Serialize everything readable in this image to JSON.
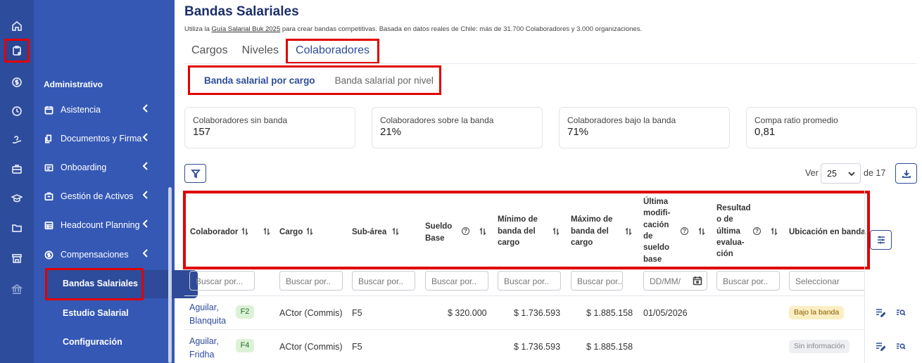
{
  "rail": {
    "icons": [
      "home-icon",
      "clipboard-icon",
      "dollar-icon",
      "clock-icon",
      "handshake-icon",
      "briefcase-icon",
      "graduation-icon",
      "folder-icon",
      "store-icon",
      "bank-icon"
    ]
  },
  "menu": {
    "section_title": "Administrativo",
    "items": [
      {
        "label": "Asistencia"
      },
      {
        "label": "Documentos y Firma"
      },
      {
        "label": "Onboarding"
      },
      {
        "label": "Gestión de Activos"
      },
      {
        "label": "Headcount Planning"
      },
      {
        "label": "Compensaciones"
      }
    ],
    "subitems": [
      {
        "label": "Bandas Salariales"
      },
      {
        "label": "Estudio Salarial"
      },
      {
        "label": "Configuración"
      }
    ]
  },
  "header": {
    "title": "Bandas Salariales",
    "subtitle_pre": "Utiliza la ",
    "subtitle_link": "Guía Salarial Buk 2025",
    "subtitle_post": " para crear bandas competitivas. Basada en datos reales de Chile: más de 31.700 Colaboradores y 3.000 organizaciones."
  },
  "tabs": [
    "Cargos",
    "Niveles",
    "Colaboradores"
  ],
  "subtabs": [
    "Banda salarial por cargo",
    "Banda salarial por nivel"
  ],
  "cards": [
    {
      "label": "Colaboradores sin banda",
      "value": "157"
    },
    {
      "label": "Colaboradores sobre la banda",
      "value": "21%"
    },
    {
      "label": "Colaboradores bajo la banda",
      "value": "71%"
    },
    {
      "label": "Compa ratio promedio",
      "value": "0,81"
    }
  ],
  "pagination": {
    "ver_label": "Ver",
    "page_size": "25",
    "of_label": "de 17"
  },
  "columns": {
    "colaborador": "Colaborador",
    "cargo": "Cargo",
    "subarea": "Sub-área",
    "sueldo_1": "Sueldo",
    "sueldo_2": "Base",
    "minimo_1": "Mínimo de",
    "minimo_2": "banda del",
    "minimo_3": "cargo",
    "maximo_1": "Máximo de",
    "maximo_2": "banda del",
    "maximo_3": "cargo",
    "ultima_1": "Última",
    "ultima_2": "modifi-",
    "ultima_3": "cación",
    "ultima_4": "de",
    "ultima_5": "sueldo",
    "ultima_6": "base",
    "result_1": "Resultad",
    "result_2": "o de",
    "result_3": "última",
    "result_4": "evalua-",
    "result_5": "ción",
    "ubicacion": "Ubicación en banda"
  },
  "filters": {
    "colaborador": "Buscar por...",
    "cargo": "Buscar por..",
    "subarea": "Buscar por..",
    "sueldo": "Buscar por..",
    "minimo": "Buscar por..",
    "maximo": "Buscar por..",
    "fecha": "DD/MM/",
    "resultado": "Buscar por..",
    "ubicacion": "Seleccionar"
  },
  "rows": [
    {
      "name_1": "Aguilar,",
      "name_2": "Blanquita",
      "level": "F2",
      "cargo": "ACtor (Commis)",
      "subarea": "F5",
      "sueldo": "$ 320.000",
      "minimo": "$ 1.736.593",
      "maximo": "$ 1.885.158",
      "fecha": "01/05/2026",
      "resultado": "",
      "ubicacion": "Bajo la banda"
    },
    {
      "name_1": "Aguilar,",
      "name_2": "Fridha",
      "level": "F4",
      "cargo": "ACtor (Commis)",
      "subarea": "F5",
      "sueldo": "",
      "minimo": "$ 1.736.593",
      "maximo": "$ 1.885.158",
      "fecha": "",
      "resultado": "",
      "ubicacion": "Sin información"
    }
  ]
}
